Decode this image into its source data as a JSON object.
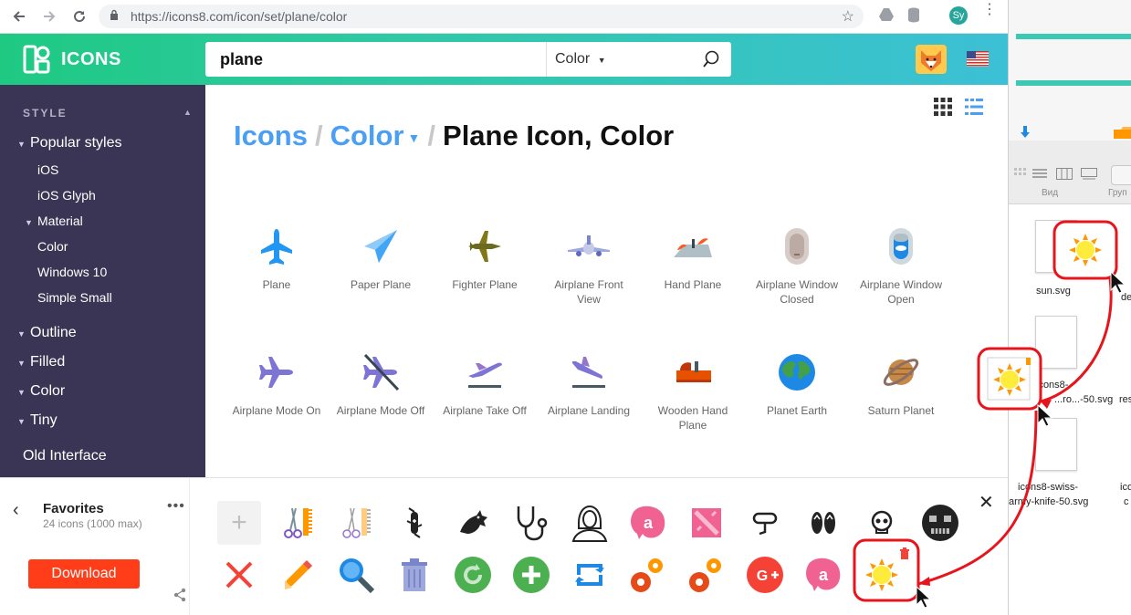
{
  "browser": {
    "url": "https://icons8.com/icon/set/plane/color",
    "profile_initials": "Sy"
  },
  "header": {
    "logo_text": "ICONS",
    "search_value": "plane",
    "style_select": "Color"
  },
  "sidebar": {
    "heading": "STYLE",
    "popular_styles": "Popular styles",
    "items": [
      "iOS",
      "iOS Glyph"
    ],
    "material": "Material",
    "material_items": [
      "Color",
      "Windows 10",
      "Simple Small"
    ],
    "groups": [
      "Outline",
      "Filled",
      "Color",
      "Tiny"
    ],
    "old_interface": "Old Interface"
  },
  "main": {
    "breadcrumb": {
      "icons": "Icons",
      "color": "Color",
      "current": "Plane Icon, Color"
    },
    "icons": [
      {
        "label": "Plane",
        "icon": "plane-icon"
      },
      {
        "label": "Paper Plane",
        "icon": "paper-plane-icon"
      },
      {
        "label": "Fighter Plane",
        "icon": "fighter-plane-icon"
      },
      {
        "label": "Airplane Front View",
        "icon": "airplane-front-view-icon"
      },
      {
        "label": "Hand Plane",
        "icon": "hand-plane-icon"
      },
      {
        "label": "Airplane Window Closed",
        "icon": "airplane-window-closed-icon"
      },
      {
        "label": "Airplane Window Open",
        "icon": "airplane-window-open-icon"
      },
      {
        "label": "Airplane Mode On",
        "icon": "airplane-mode-on-icon"
      },
      {
        "label": "Airplane Mode Off",
        "icon": "airplane-mode-off-icon"
      },
      {
        "label": "Airplane Take Off",
        "icon": "airplane-take-off-icon"
      },
      {
        "label": "Airplane Landing",
        "icon": "airplane-landing-icon"
      },
      {
        "label": "Wooden Hand Plane",
        "icon": "wooden-hand-plane-icon"
      },
      {
        "label": "Planet Earth",
        "icon": "planet-earth-icon"
      },
      {
        "label": "Saturn Planet",
        "icon": "saturn-planet-icon"
      }
    ]
  },
  "favorites": {
    "title": "Favorites",
    "count": "24 icons (1000 max)",
    "download": "Download",
    "icons_row1": [
      "add-icon",
      "scissors-comb-icon",
      "scissors-comb-outline-icon",
      "swiss-army-knife-icon",
      "dragon-icon",
      "stethoscope-icon",
      "woman-icon",
      "avast-icon",
      "dota-icon",
      "scuba-icon",
      "flip-flops-icon",
      "skull-icon",
      "skull-filled-icon"
    ],
    "icons_row2": [
      "close-icon",
      "pencil-icon",
      "magnifier-icon",
      "trash-icon",
      "refresh-icon",
      "plus-icon",
      "sync-icon",
      "settings-icon",
      "settings-icon",
      "google-plus-icon",
      "avast-icon",
      "sun-icon"
    ]
  },
  "finder": {
    "view_label": "Вид",
    "group_label": "Груп",
    "files": [
      "sun.svg",
      "icons8-",
      "...ro...-50.svg",
      "icons8-swiss-",
      "army-knife-50.svg"
    ],
    "partial_labels": [
      "de",
      "res",
      "ico",
      "c"
    ]
  },
  "colors": {
    "accent_blue": "#4a9ff5",
    "header_green": "#1fc982",
    "sidebar_bg": "#3a3554",
    "download_red": "#ff3d19",
    "annotation_red": "#e8141b"
  }
}
